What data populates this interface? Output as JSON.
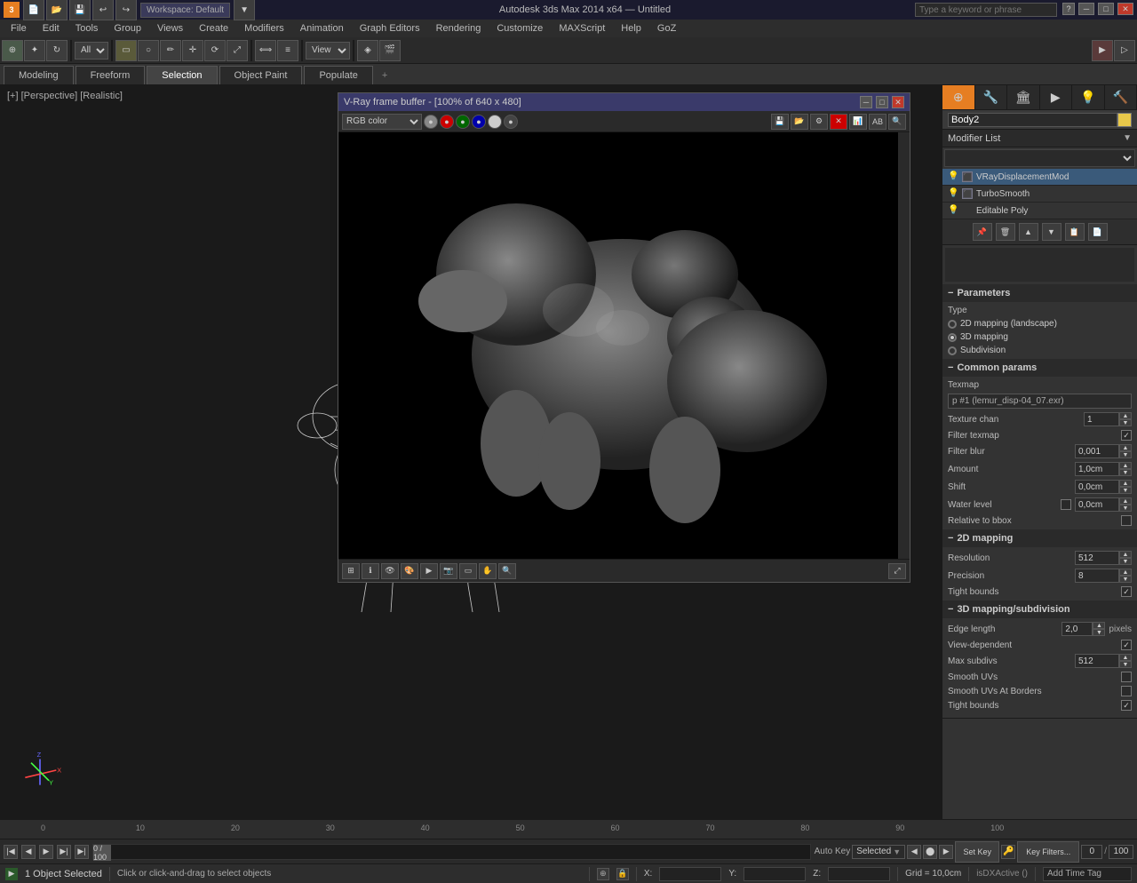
{
  "titlebar": {
    "app_name": "Autodesk 3ds Max 2014 x64",
    "file_name": "Untitled",
    "workspace": "Workspace: Default",
    "search_placeholder": "Type a keyword or phrase",
    "min_label": "─",
    "max_label": "□",
    "close_label": "✕"
  },
  "menubar": {
    "items": [
      "File",
      "Edit",
      "Tools",
      "Group",
      "Views",
      "Create",
      "Modifiers",
      "Animation",
      "Graph Editors",
      "Rendering",
      "Customize",
      "MAXScript",
      "Help",
      "GoZ"
    ]
  },
  "tabs": {
    "items": [
      "Modeling",
      "Freeform",
      "Selection",
      "Object Paint",
      "Populate"
    ],
    "active": "Selection",
    "pin_label": "+"
  },
  "viewport": {
    "label": "[+] [Perspective] [Realistic]",
    "axes_labels": [
      "X",
      "Y",
      "Z"
    ],
    "frame_range": "0 / 100"
  },
  "vray_window": {
    "title": "V-Ray frame buffer - [100% of 640 x 480]",
    "color_mode": "RGB color",
    "min_label": "─",
    "restore_label": "□",
    "close_label": "✕"
  },
  "rightpanel": {
    "object_name": "Body2",
    "modifier_list_label": "Modifier List",
    "modifiers": [
      {
        "name": "VRayDisplacementMod",
        "active": true
      },
      {
        "name": "TurboSmooth",
        "active": false
      },
      {
        "name": "Editable Poly",
        "active": false
      }
    ],
    "params_header": "Parameters",
    "type_label": "Type",
    "type_options": [
      {
        "label": "2D mapping (landscape)",
        "selected": false
      },
      {
        "label": "3D mapping",
        "selected": true
      },
      {
        "label": "Subdivision",
        "selected": false
      }
    ],
    "common_params_label": "Common params",
    "texmap_label": "Texmap",
    "texmap_value": "p #1 (lemur_disp-04_07.exr)",
    "texture_chan_label": "Texture chan",
    "texture_chan_value": "1",
    "filter_texmap_label": "Filter texmap",
    "filter_blur_label": "Filter blur",
    "filter_blur_value": "0,001",
    "amount_label": "Amount",
    "amount_value": "1,0cm",
    "shift_label": "Shift",
    "shift_value": "0,0cm",
    "water_level_label": "Water level",
    "water_level_value": "0,0cm",
    "relative_to_bbox_label": "Relative to bbox",
    "mapping_2d_label": "2D mapping",
    "resolution_label": "Resolution",
    "resolution_value": "512",
    "precision_label": "Precision",
    "precision_value": "8",
    "tight_bounds_label": "Tight bounds",
    "mapping_3d_label": "3D mapping/subdivision",
    "edge_length_label": "Edge length",
    "edge_length_value": "2,0",
    "pixels_label": "pixels",
    "view_dependent_label": "View-dependent",
    "max_subdivs_label": "Max subdivs",
    "max_subdivs_value": "512",
    "smooth_uvs_label": "Smooth UVs",
    "smooth_uvs_borders_label": "Smooth UVs At Borders",
    "tight_bounds_bottom_label": "Tight bounds"
  },
  "statusbar": {
    "object_selected": "1 Object Selected",
    "hint": "Click or click-and-drag to select objects",
    "x_label": "X:",
    "y_label": "Y:",
    "z_label": "Z:",
    "grid_label": "Grid = 10,0cm",
    "auto_key_label": "Auto Key",
    "selected_label": "Selected",
    "set_key_label": "Set Key",
    "key_filters_label": "Key Filters...",
    "frame_num": "0",
    "is_dx_active": "isDXActive ()",
    "add_time_tag": "Add Time Tag"
  },
  "timeline": {
    "frame_range": "0 / 100",
    "frame_labels": [
      "0",
      "10",
      "20",
      "30",
      "40",
      "50",
      "60",
      "70",
      "80",
      "90",
      "100"
    ]
  }
}
